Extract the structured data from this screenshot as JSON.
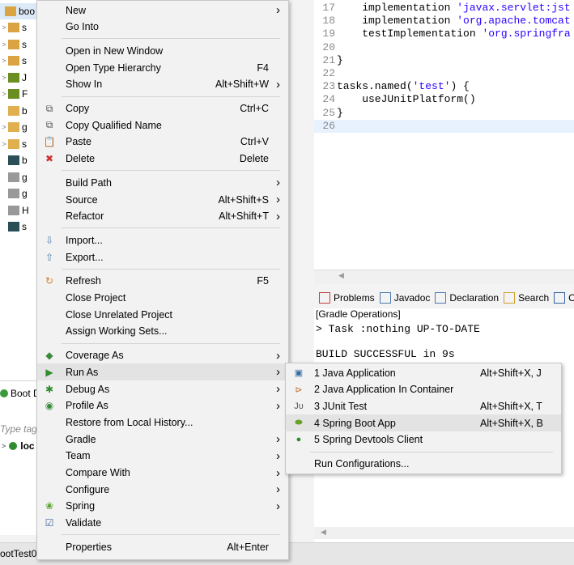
{
  "explorer": {
    "root_label": "boo",
    "rows": [
      {
        "tw": ">",
        "label": "s",
        "color": "#d9a441"
      },
      {
        "tw": ">",
        "label": "s",
        "color": "#d9a441"
      },
      {
        "tw": ">",
        "label": "s",
        "color": "#d9a441"
      },
      {
        "tw": ">",
        "label": "J",
        "color": "#6b8e23"
      },
      {
        "tw": ">",
        "label": "F",
        "color": "#6b8e23"
      },
      {
        "tw": "",
        "label": "b",
        "color": "#e0b050"
      },
      {
        "tw": ">",
        "label": "g",
        "color": "#e0b050"
      },
      {
        "tw": ">",
        "label": "s",
        "color": "#e0b050"
      },
      {
        "tw": "",
        "label": "b",
        "color": "#2b4f57"
      },
      {
        "tw": "",
        "label": "g",
        "color": "#999999"
      },
      {
        "tw": "",
        "label": "g",
        "color": "#999999"
      },
      {
        "tw": "",
        "label": "H",
        "color": "#999999"
      },
      {
        "tw": "",
        "label": "s",
        "color": "#2b4f57"
      }
    ]
  },
  "dashboard": {
    "title": "Boot D",
    "filter_placeholder": "Type tags",
    "local_label": "loc",
    "status_text": "ootTest0"
  },
  "editor": {
    "lines": [
      {
        "n": "17",
        "code": "    implementation ",
        "str": "'javax.servlet:jst"
      },
      {
        "n": "18",
        "code": "    implementation ",
        "str": "'org.apache.tomcat"
      },
      {
        "n": "19",
        "code": "    testImplementation ",
        "str": "'org.springfra"
      },
      {
        "n": "20",
        "code": "",
        "str": ""
      },
      {
        "n": "21",
        "code": "}",
        "str": ""
      },
      {
        "n": "22",
        "code": "",
        "str": ""
      },
      {
        "n": "23",
        "code": "tasks.named(",
        "str": "'test'",
        "tail": ") {"
      },
      {
        "n": "24",
        "code": "    useJUnitPlatform()",
        "str": ""
      },
      {
        "n": "25",
        "code": "}",
        "str": ""
      },
      {
        "n": "26",
        "code": "",
        "str": ""
      }
    ]
  },
  "console": {
    "tabs": [
      "Problems",
      "Javadoc",
      "Declaration",
      "Search",
      "Co"
    ],
    "header": "[Gradle Operations]",
    "line1": "> Task :nothing UP-TO-DATE",
    "line2": "BUILD SUCCESSFUL in 9s"
  },
  "menu": {
    "items": [
      {
        "label": "New",
        "shortcut": "",
        "arrow": true,
        "icon": ""
      },
      {
        "label": "Go Into",
        "shortcut": "",
        "arrow": false,
        "icon": ""
      },
      {
        "sep": true
      },
      {
        "label": "Open in New Window",
        "shortcut": "",
        "arrow": false,
        "icon": ""
      },
      {
        "label": "Open Type Hierarchy",
        "shortcut": "F4",
        "arrow": false,
        "icon": ""
      },
      {
        "label": "Show In",
        "shortcut": "Alt+Shift+W",
        "arrow": true,
        "icon": ""
      },
      {
        "sep": true
      },
      {
        "label": "Copy",
        "shortcut": "Ctrl+C",
        "arrow": false,
        "icon": "copy-icon"
      },
      {
        "label": "Copy Qualified Name",
        "shortcut": "",
        "arrow": false,
        "icon": "copy-qualified-icon"
      },
      {
        "label": "Paste",
        "shortcut": "Ctrl+V",
        "arrow": false,
        "icon": "paste-icon"
      },
      {
        "label": "Delete",
        "shortcut": "Delete",
        "arrow": false,
        "icon": "delete-icon"
      },
      {
        "sep": true
      },
      {
        "label": "Build Path",
        "shortcut": "",
        "arrow": true,
        "icon": ""
      },
      {
        "label": "Source",
        "shortcut": "Alt+Shift+S",
        "arrow": true,
        "icon": ""
      },
      {
        "label": "Refactor",
        "shortcut": "Alt+Shift+T",
        "arrow": true,
        "icon": ""
      },
      {
        "sep": true
      },
      {
        "label": "Import...",
        "shortcut": "",
        "arrow": false,
        "icon": "import-icon"
      },
      {
        "label": "Export...",
        "shortcut": "",
        "arrow": false,
        "icon": "export-icon"
      },
      {
        "sep": true
      },
      {
        "label": "Refresh",
        "shortcut": "F5",
        "arrow": false,
        "icon": "refresh-icon"
      },
      {
        "label": "Close Project",
        "shortcut": "",
        "arrow": false,
        "icon": ""
      },
      {
        "label": "Close Unrelated Project",
        "shortcut": "",
        "arrow": false,
        "icon": ""
      },
      {
        "label": "Assign Working Sets...",
        "shortcut": "",
        "arrow": false,
        "icon": ""
      },
      {
        "sep": true
      },
      {
        "label": "Coverage As",
        "shortcut": "",
        "arrow": true,
        "icon": "coverage-icon"
      },
      {
        "label": "Run As",
        "shortcut": "",
        "arrow": true,
        "icon": "run-icon",
        "highlight": true
      },
      {
        "label": "Debug As",
        "shortcut": "",
        "arrow": true,
        "icon": "debug-icon"
      },
      {
        "label": "Profile As",
        "shortcut": "",
        "arrow": true,
        "icon": "profile-icon"
      },
      {
        "label": "Restore from Local History...",
        "shortcut": "",
        "arrow": false,
        "icon": ""
      },
      {
        "label": "Gradle",
        "shortcut": "",
        "arrow": true,
        "icon": ""
      },
      {
        "label": "Team",
        "shortcut": "",
        "arrow": true,
        "icon": ""
      },
      {
        "label": "Compare With",
        "shortcut": "",
        "arrow": true,
        "icon": ""
      },
      {
        "label": "Configure",
        "shortcut": "",
        "arrow": true,
        "icon": ""
      },
      {
        "label": "Spring",
        "shortcut": "",
        "arrow": true,
        "icon": "spring-icon"
      },
      {
        "label": "Validate",
        "shortcut": "",
        "arrow": false,
        "icon": "validate-icon"
      },
      {
        "sep": true
      },
      {
        "label": "Properties",
        "shortcut": "Alt+Enter",
        "arrow": false,
        "icon": ""
      }
    ]
  },
  "submenu": {
    "items": [
      {
        "label": "1 Java Application",
        "shortcut": "Alt+Shift+X, J",
        "icon": "java-app-icon"
      },
      {
        "label": "2 Java Application In Container",
        "shortcut": "",
        "icon": "container-icon"
      },
      {
        "label": "3 JUnit Test",
        "shortcut": "Alt+Shift+X, T",
        "icon": "junit-icon"
      },
      {
        "label": "4 Spring Boot App",
        "shortcut": "Alt+Shift+X, B",
        "icon": "spring-boot-icon",
        "highlight": true
      },
      {
        "label": "5 Spring Devtools Client",
        "shortcut": "",
        "icon": "devtools-icon"
      },
      {
        "sep": true
      },
      {
        "label": "Run Configurations...",
        "shortcut": "",
        "icon": ""
      }
    ]
  }
}
